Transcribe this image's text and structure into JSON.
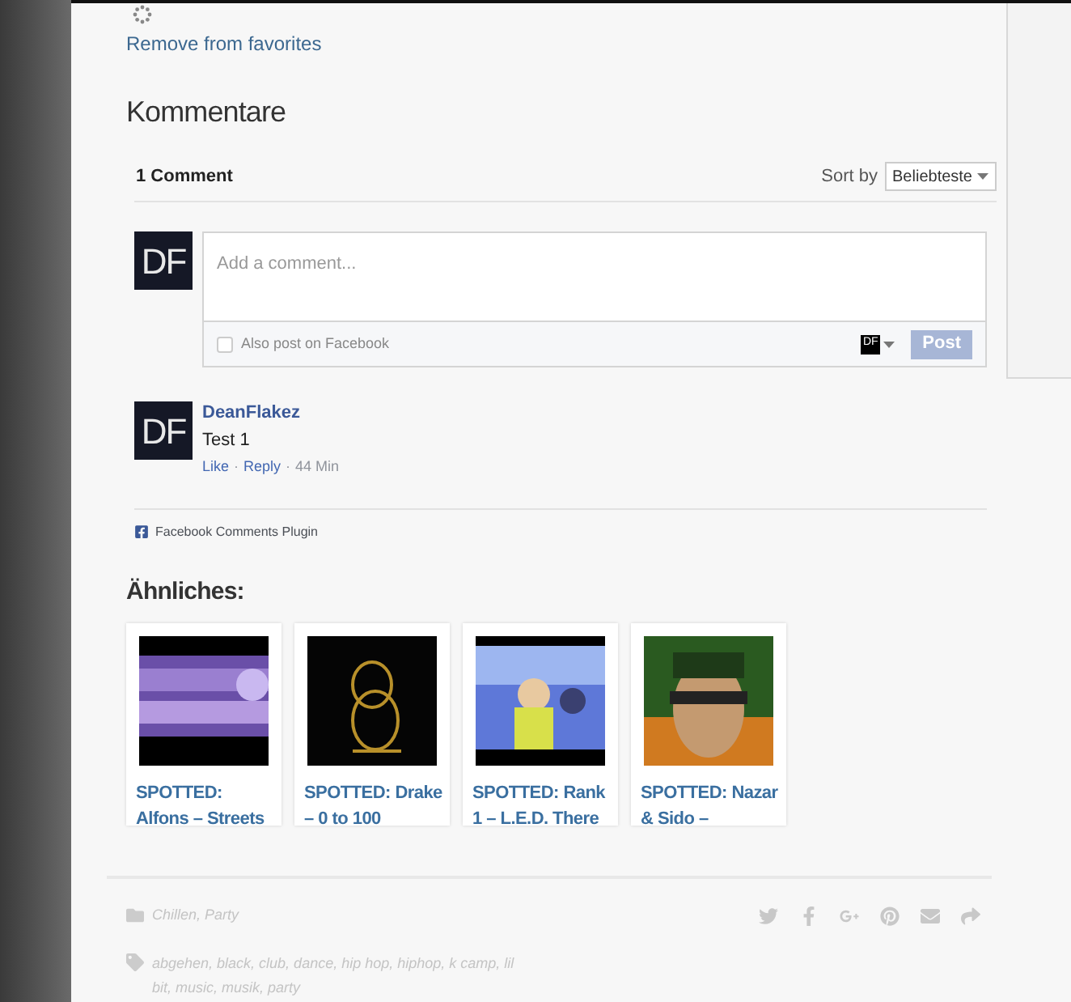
{
  "favorites": {
    "link": "Remove from favorites"
  },
  "comments": {
    "heading": "Kommentare",
    "count": "1 Comment",
    "sort_label": "Sort by",
    "sort_value": "Beliebteste",
    "composer": {
      "avatar": "DF",
      "placeholder": "Add a comment...",
      "also_post": "Also post on Facebook",
      "also_post_checked": false,
      "identity": "DF",
      "post_button": "Post",
      "post_disabled": true
    },
    "items": [
      {
        "avatar": "DF",
        "author": "DeanFlakez",
        "text": "Test 1",
        "actions": [
          "Like",
          "Reply"
        ],
        "separator": "·",
        "time": "44 Min"
      }
    ],
    "plugin": "Facebook Comments Plugin"
  },
  "related": {
    "heading": "Ähnliches:",
    "items": [
      {
        "title_lines": [
          "SPOTTED:",
          "Alfons – Streets"
        ],
        "kind": "picture"
      },
      {
        "title_lines": [
          "SPOTTED: Drake",
          "– 0 to 100"
        ],
        "kind": "picture"
      },
      {
        "title_lines": [
          "SPOTTED: Rank",
          "1 – L.E.D. There"
        ],
        "kind": "picture"
      },
      {
        "title_lines": [
          "SPOTTED: Nazar",
          "& Sido –"
        ],
        "kind": "picture"
      }
    ]
  },
  "footer": {
    "categories": "Chillen, Party",
    "tags_lines": [
      "abgehen, black, club, dance, hip hop, hiphop, k camp, lil",
      "bit, music, musik, party"
    ],
    "share": [
      {
        "kind": "twitter"
      },
      {
        "kind": "facebook"
      },
      {
        "kind": "googleplus"
      },
      {
        "kind": "pinterest"
      },
      {
        "kind": "email"
      },
      {
        "kind": "share"
      }
    ]
  }
}
